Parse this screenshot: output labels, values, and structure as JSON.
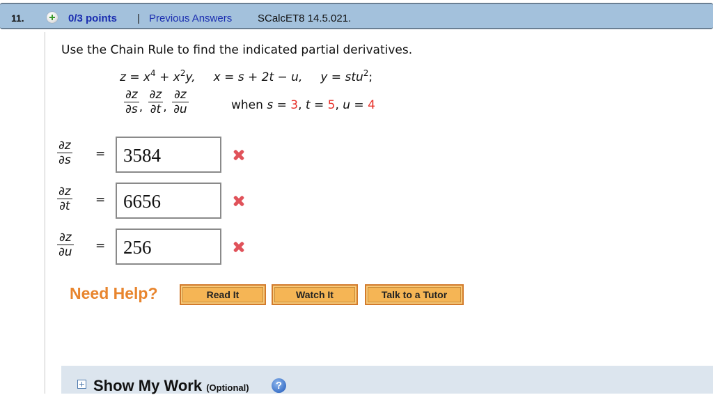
{
  "header": {
    "question_number": "11.",
    "points_icon": "plus-circle-icon",
    "points": "0/3 points",
    "separator": "|",
    "previous_answers_link": "Previous Answers",
    "problem_code": "SCalcET8 14.5.021."
  },
  "question": {
    "prompt": "Use the Chain Rule to find the indicated partial derivatives.",
    "equations": {
      "z_def": {
        "lhs": "z = x",
        "exp1": "4",
        "mid": " + x",
        "exp2": "2",
        "tail": "y,"
      },
      "x_def": "x = s + 2t − u,",
      "y_def": {
        "text": "y = stu",
        "exp": "2",
        "tail": ";"
      }
    },
    "derivatives": [
      {
        "num": "∂z",
        "den": "∂s"
      },
      {
        "num": "∂z",
        "den": "∂t"
      },
      {
        "num": "∂z",
        "den": "∂u"
      }
    ],
    "condition": {
      "prefix": "when",
      "s_label": "s = ",
      "s_value": "3",
      "t_label": "t = ",
      "t_value": "5",
      "u_label": "u = ",
      "u_value": "4"
    },
    "value_color": "#e8322b"
  },
  "answers": [
    {
      "num": "∂z",
      "den": "∂s",
      "equals": "=",
      "value": "3584",
      "status": "incorrect",
      "status_icon": "x-mark-icon"
    },
    {
      "num": "∂z",
      "den": "∂t",
      "equals": "=",
      "value": "6656",
      "status": "incorrect",
      "status_icon": "x-mark-icon"
    },
    {
      "num": "∂z",
      "den": "∂u",
      "equals": "=",
      "value": "256",
      "status": "incorrect",
      "status_icon": "x-mark-icon"
    }
  ],
  "help": {
    "label": "Need Help?",
    "buttons": [
      "Read It",
      "Watch It",
      "Talk to a Tutor"
    ]
  },
  "show_work": {
    "expand_icon": "plus-square-icon",
    "title": "Show My Work",
    "optional": "(Optional)",
    "help_icon": "question-mark-icon"
  },
  "colors": {
    "header_bg": "#a3c1dc",
    "link_blue": "#1a2db0",
    "incorrect_red": "#e0525a",
    "help_orange": "#e8852e",
    "button_orange": "#f5b555",
    "work_bg": "#dce5ee"
  }
}
